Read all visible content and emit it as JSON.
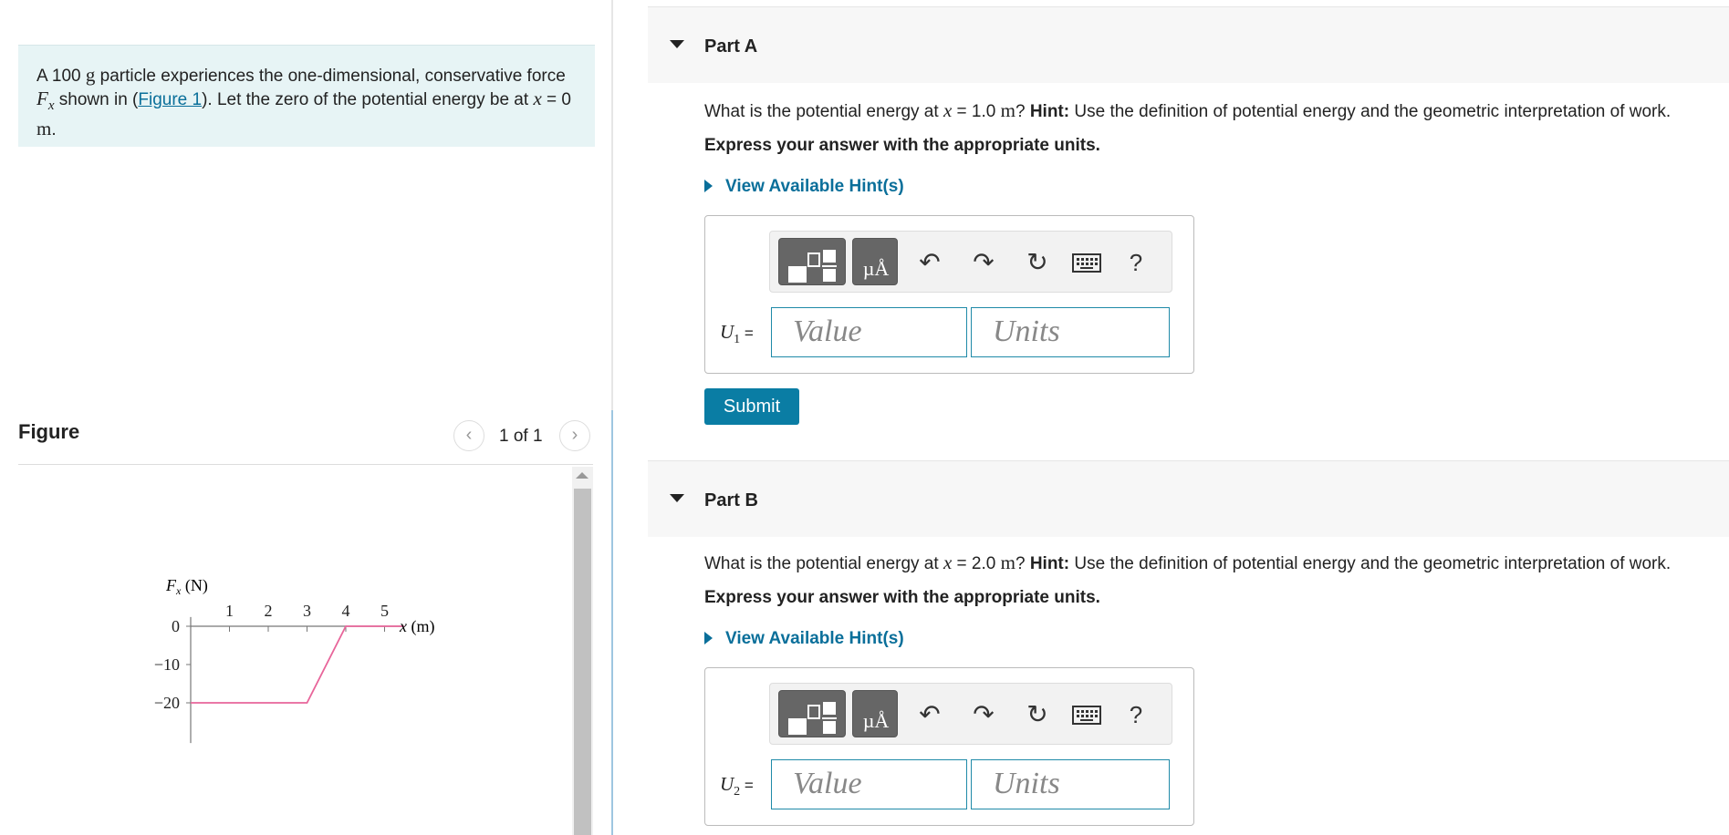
{
  "problem": {
    "text_a": "A 100 ",
    "mass_unit": "g",
    "text_b": " particle experiences the one-dimensional, conservative force ",
    "force_symbol": "F",
    "force_sub": "x",
    "text_c": " shown in (",
    "figure_link": "Figure 1",
    "text_d": "). Let the zero of the potential energy be at ",
    "x_symbol": "x",
    "text_e": " = 0 ",
    "meter_unit": "m",
    "text_f": "."
  },
  "figure": {
    "title": "Figure",
    "counter": "1 of 1",
    "prev_icon": "chevron-left-icon",
    "next_icon": "chevron-right-icon"
  },
  "chart_data": {
    "type": "line",
    "title": "",
    "ylabel": "F_x (N)",
    "ylabel_main": "F",
    "ylabel_sub": "x",
    "ylabel_unit": " (N)",
    "xlabel": "x (m)",
    "xlabel_var": "x",
    "xlabel_unit": " (m)",
    "x_ticks": [
      "1",
      "2",
      "3",
      "4",
      "5"
    ],
    "y_ticks": [
      "0",
      "−10",
      "−20"
    ],
    "xlim": [
      0,
      5.5
    ],
    "ylim": [
      -30,
      2
    ],
    "series": [
      {
        "x": [
          0,
          3,
          4,
          5.5
        ],
        "y": [
          -20,
          -20,
          0,
          0
        ]
      }
    ],
    "line_color": "#e8659a",
    "axis_color": "#777777"
  },
  "parts": [
    {
      "title": "Part A",
      "q_pre": "What is the potential energy at ",
      "q_var": "x",
      "q_eq": " = 1.0 ",
      "q_unit": "m",
      "q_mid": "? ",
      "q_hint_label": "Hint:",
      "q_post": " Use the definition of potential energy and the geometric interpretation of work.",
      "instruction": "Express your answer with the appropriate units.",
      "hint_link": "View Available Hint(s)",
      "var_label": "U",
      "var_sub": "1",
      "var_eq": " =",
      "value_placeholder": "Value",
      "units_placeholder": "Units",
      "toolbar_units_glyph": "µÅ",
      "help_glyph": "?"
    },
    {
      "title": "Part B",
      "q_pre": "What is the potential energy at ",
      "q_var": "x",
      "q_eq": " = 2.0 ",
      "q_unit": "m",
      "q_mid": "? ",
      "q_hint_label": "Hint:",
      "q_post": " Use the definition of potential energy and the geometric interpretation of work.",
      "instruction": "Express your answer with the appropriate units.",
      "hint_link": "View Available Hint(s)",
      "var_label": "U",
      "var_sub": "2",
      "var_eq": " =",
      "value_placeholder": "Value",
      "units_placeholder": "Units",
      "toolbar_units_glyph": "µÅ",
      "help_glyph": "?"
    }
  ],
  "submit_label": "Submit",
  "colors": {
    "accent": "#0a7da4",
    "link": "#0a6f9a",
    "problem_bg": "#e7f4f5"
  }
}
